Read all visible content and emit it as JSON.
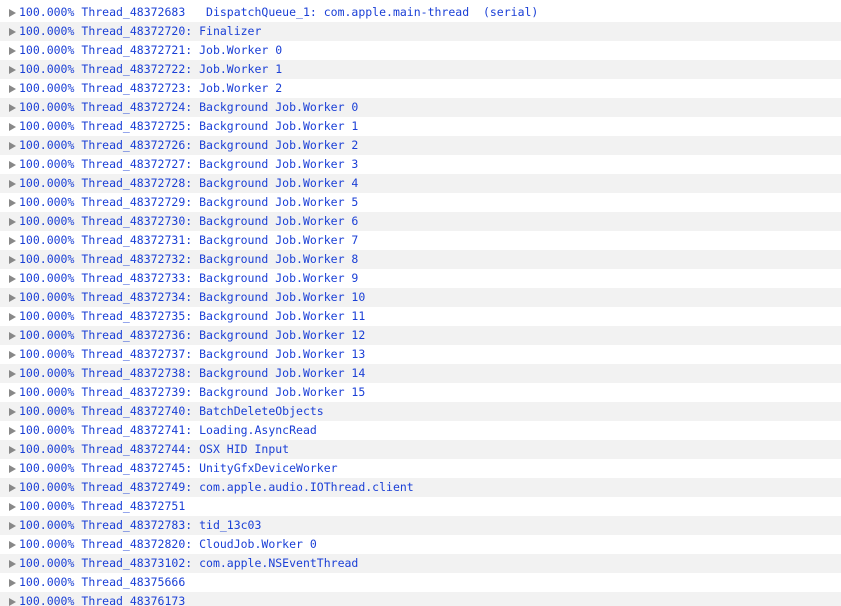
{
  "rows": [
    {
      "percent": "100.000%",
      "label": "Thread_48372683   DispatchQueue_1: com.apple.main-thread  (serial)"
    },
    {
      "percent": "100.000%",
      "label": "Thread_48372720: Finalizer"
    },
    {
      "percent": "100.000%",
      "label": "Thread_48372721: Job.Worker 0"
    },
    {
      "percent": "100.000%",
      "label": "Thread_48372722: Job.Worker 1"
    },
    {
      "percent": "100.000%",
      "label": "Thread_48372723: Job.Worker 2"
    },
    {
      "percent": "100.000%",
      "label": "Thread_48372724: Background Job.Worker 0"
    },
    {
      "percent": "100.000%",
      "label": "Thread_48372725: Background Job.Worker 1"
    },
    {
      "percent": "100.000%",
      "label": "Thread_48372726: Background Job.Worker 2"
    },
    {
      "percent": "100.000%",
      "label": "Thread_48372727: Background Job.Worker 3"
    },
    {
      "percent": "100.000%",
      "label": "Thread_48372728: Background Job.Worker 4"
    },
    {
      "percent": "100.000%",
      "label": "Thread_48372729: Background Job.Worker 5"
    },
    {
      "percent": "100.000%",
      "label": "Thread_48372730: Background Job.Worker 6"
    },
    {
      "percent": "100.000%",
      "label": "Thread_48372731: Background Job.Worker 7"
    },
    {
      "percent": "100.000%",
      "label": "Thread_48372732: Background Job.Worker 8"
    },
    {
      "percent": "100.000%",
      "label": "Thread_48372733: Background Job.Worker 9"
    },
    {
      "percent": "100.000%",
      "label": "Thread_48372734: Background Job.Worker 10"
    },
    {
      "percent": "100.000%",
      "label": "Thread_48372735: Background Job.Worker 11"
    },
    {
      "percent": "100.000%",
      "label": "Thread_48372736: Background Job.Worker 12"
    },
    {
      "percent": "100.000%",
      "label": "Thread_48372737: Background Job.Worker 13"
    },
    {
      "percent": "100.000%",
      "label": "Thread_48372738: Background Job.Worker 14"
    },
    {
      "percent": "100.000%",
      "label": "Thread_48372739: Background Job.Worker 15"
    },
    {
      "percent": "100.000%",
      "label": "Thread_48372740: BatchDeleteObjects"
    },
    {
      "percent": "100.000%",
      "label": "Thread_48372741: Loading.AsyncRead"
    },
    {
      "percent": "100.000%",
      "label": "Thread_48372744: OSX HID Input"
    },
    {
      "percent": "100.000%",
      "label": "Thread_48372745: UnityGfxDeviceWorker"
    },
    {
      "percent": "100.000%",
      "label": "Thread_48372749: com.apple.audio.IOThread.client"
    },
    {
      "percent": "100.000%",
      "label": "Thread_48372751"
    },
    {
      "percent": "100.000%",
      "label": "Thread_48372783: tid_13c03"
    },
    {
      "percent": "100.000%",
      "label": "Thread_48372820: CloudJob.Worker 0"
    },
    {
      "percent": "100.000%",
      "label": "Thread_48373102: com.apple.NSEventThread"
    },
    {
      "percent": "100.000%",
      "label": "Thread_48375666"
    },
    {
      "percent": "100.000%",
      "label": "Thread_48376173"
    }
  ],
  "icons": {
    "disclosure": "disclosure-triangle-right-icon"
  },
  "colors": {
    "text": "#1a3fd6",
    "row_alt": "#f2f2f2",
    "triangle": "#888888"
  }
}
